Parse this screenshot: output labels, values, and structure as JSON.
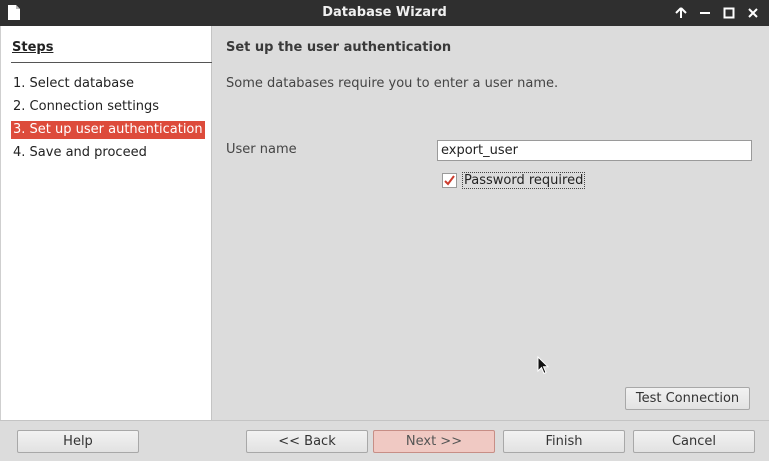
{
  "window": {
    "title": "Database Wizard"
  },
  "steps": {
    "title": "Steps",
    "items": [
      {
        "label": "1. Select database",
        "active": false
      },
      {
        "label": "2. Connection settings",
        "active": false
      },
      {
        "label": "3. Set up user authentication",
        "active": true
      },
      {
        "label": "4. Save and proceed",
        "active": false
      }
    ]
  },
  "page": {
    "heading": "Set up the user authentication",
    "description": "Some databases require you to enter a user name.",
    "user_name_label": "User name",
    "user_name_value": "export_user",
    "password_required_label": "Password required",
    "password_required_checked": true,
    "test_connection_label": "Test Connection"
  },
  "footer": {
    "help_label": "Help",
    "back_label": "<< Back",
    "next_label": "Next >>",
    "finish_label": "Finish",
    "cancel_label": "Cancel"
  },
  "colors": {
    "accent": "#dd4b3b",
    "titlebar": "#2f2f2f",
    "checkmark": "#cc3c2e",
    "next_button": "#f0c9c3"
  },
  "icons": {
    "app": "document-icon",
    "window_controls": [
      "keep-above-icon",
      "minimize-icon",
      "maximize-icon",
      "close-icon"
    ],
    "cursor": "mouse-pointer-icon"
  }
}
